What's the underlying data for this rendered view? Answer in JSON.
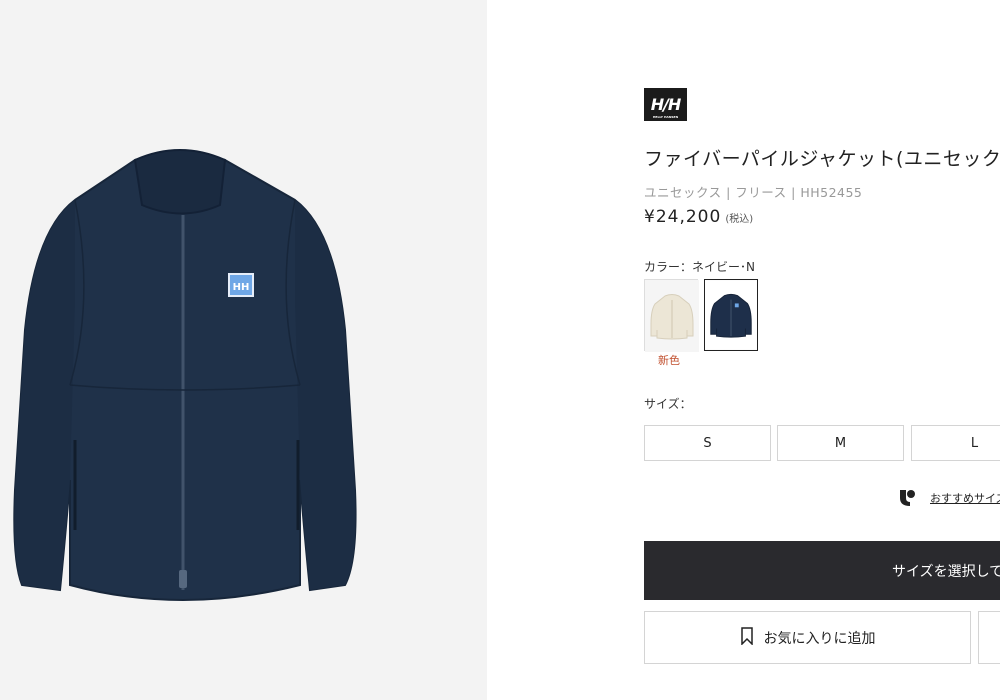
{
  "brand": {
    "logo_text": "H/H",
    "logo_subtext": "HELLY HANSEN"
  },
  "product": {
    "title": "ファイバーパイルジャケット(ユニセックス)",
    "meta": "ユニセックス | フリース | HH52455",
    "price": "¥24,200",
    "tax_note": "(税込)"
  },
  "color": {
    "label": "カラー：",
    "selected_value": "ネイビー･N",
    "swatches": [
      {
        "name": "ivory",
        "color": "#ece6d6"
      },
      {
        "name": "navy",
        "color": "#1e2f4a"
      }
    ],
    "new_badge": "新色"
  },
  "size": {
    "label": "サイズ：",
    "options": [
      "S",
      "M",
      "L"
    ]
  },
  "recommend": {
    "text": "おすすめサイズ",
    "icon": "size-advisor-icon"
  },
  "actions": {
    "add_to_cart": "サイズを選択して",
    "favorite": "お気に入りに追加",
    "favorite_icon": "bookmark-icon"
  },
  "theme": {
    "primary_dark": "#2a2a2e",
    "accent_new": "#c1502f",
    "product_color": "#1e2f4a"
  }
}
